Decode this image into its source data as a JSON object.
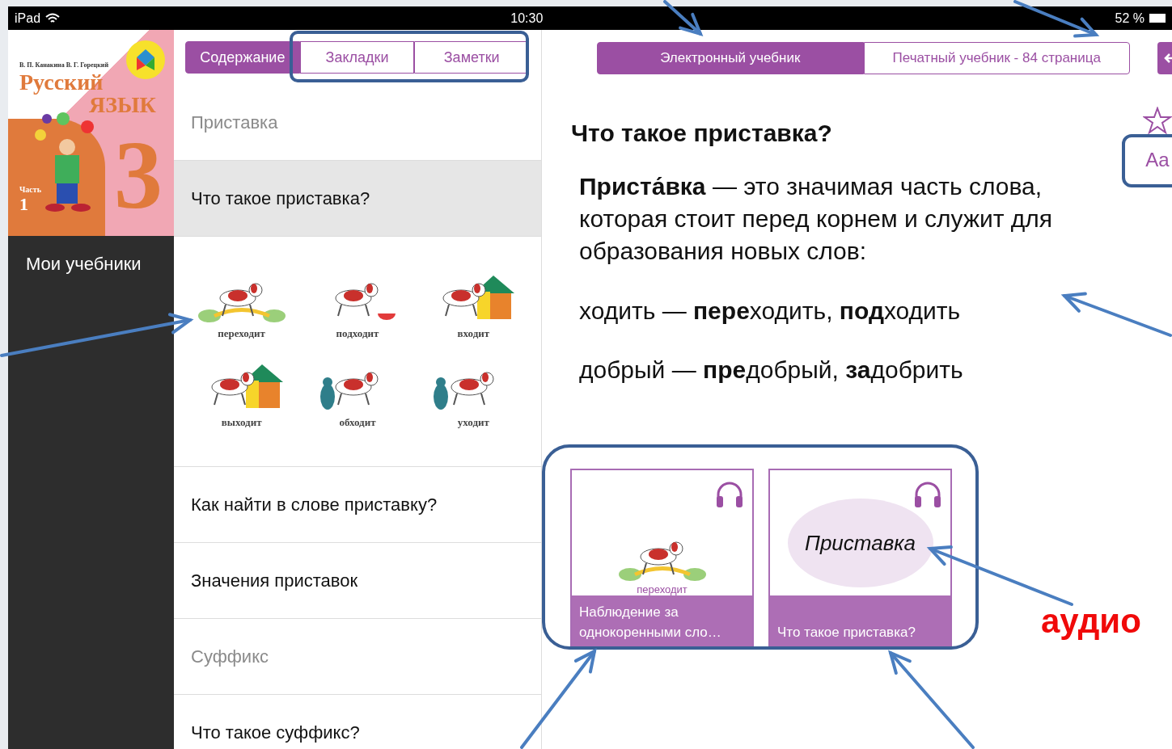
{
  "status_bar": {
    "device": "iPad",
    "time": "10:30",
    "battery": "52 %"
  },
  "sidebar": {
    "cover": {
      "authors": "В. П. Канакина   В. Г. Горецкий",
      "title_line_1": "Русский",
      "title_line_2": "ЯЗЫК",
      "part_label": "Часть",
      "part_number": "1",
      "grade": "3"
    },
    "my_books": "Мои учебники"
  },
  "contents_tabs": [
    {
      "label": "Содержание",
      "selected": true
    },
    {
      "label": "Закладки",
      "selected": false
    },
    {
      "label": "Заметки",
      "selected": false
    }
  ],
  "contents": [
    {
      "kind": "section",
      "label": "Приставка",
      "selected": false
    },
    {
      "kind": "topic",
      "label": "Что такое приставка?",
      "selected": true
    },
    {
      "kind": "pictures",
      "pictures": [
        {
          "kind": "bridge",
          "caption": "переходит"
        },
        {
          "kind": "bowl",
          "caption": "подходит"
        },
        {
          "kind": "house_in",
          "caption": "входит"
        },
        {
          "kind": "house_out",
          "caption": "выходит"
        },
        {
          "kind": "cat",
          "caption": "обходит"
        },
        {
          "kind": "cat_away",
          "caption": "уходит"
        }
      ]
    },
    {
      "kind": "topic",
      "label": "Как найти в слове приставку?",
      "selected": false
    },
    {
      "kind": "topic",
      "label": "Значения приставок",
      "selected": false
    },
    {
      "kind": "section",
      "label": "Суффикс",
      "selected": false
    },
    {
      "kind": "topic",
      "label": "Что такое суффикс?",
      "selected": false
    }
  ],
  "book_tabs": [
    {
      "label": "Электронный учебник",
      "selected": true
    },
    {
      "label": "Печатный учебник - 84 страница",
      "selected": false
    }
  ],
  "article": {
    "title": "Что такое приставка?",
    "definition": "**Приста́вка** — это значимая часть слова, которая стоит перед корнем и служит для образования новых слов:",
    "examples": [
      "ходить — **пере**ходить, **под**ходить",
      "добрый — **пре**добрый, **за**добрить"
    ]
  },
  "tools": {
    "font_button": "Aa"
  },
  "media_cards": [
    {
      "kind": "picture",
      "image_caption": "переходит",
      "caption": "Наблюдение за однокоренными сло…"
    },
    {
      "kind": "audio_word",
      "word": "Приставка",
      "caption": "Что такое приставка?"
    }
  ],
  "annotations": {
    "audio_label": "аудио"
  }
}
